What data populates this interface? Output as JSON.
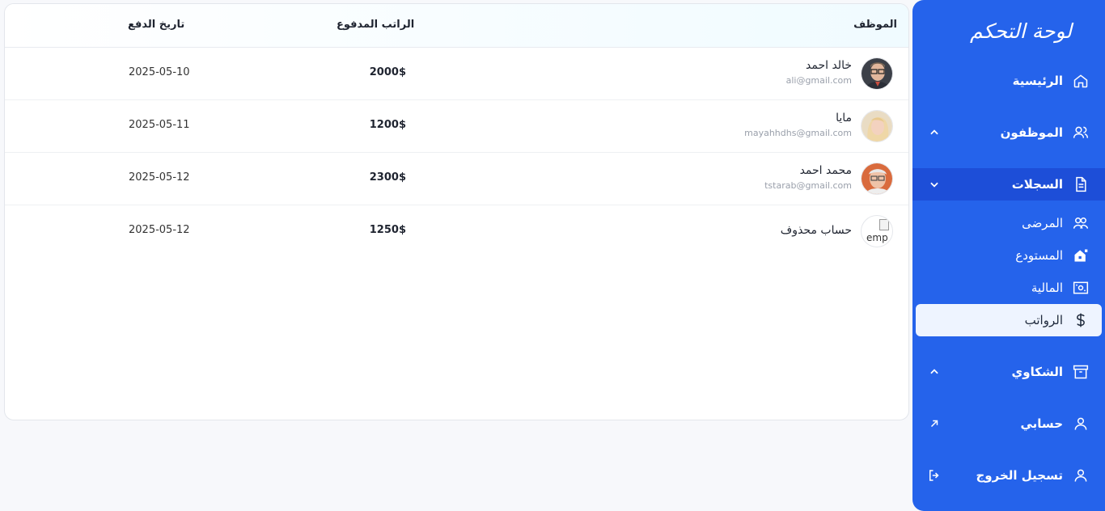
{
  "sidebar": {
    "title": "لوحة التحكم",
    "items": {
      "home": "الرئيسية",
      "employees": "الموظفون",
      "records": "السجلات",
      "complaints": "الشكاوي",
      "account": "حسابي",
      "logout": "تسجيل الخروج"
    },
    "records_sub": {
      "patients": "المرضى",
      "warehouse": "المستودع",
      "finance": "المالية",
      "salaries": "الرواتب"
    },
    "colors": {
      "background": "#2563eb",
      "active": "#1d4ed8",
      "selected": "#eef4ff"
    }
  },
  "table": {
    "headers": {
      "employee": "الموظف",
      "salary": "الراتب المدفوع",
      "date": "تاريخ الدفع"
    },
    "rows": [
      {
        "name": "خالد احمد",
        "email": "ali@gmail.com",
        "amount": "2000$",
        "date": "2025-05-10",
        "avatar": "avatar-man-glasses"
      },
      {
        "name": "مايا",
        "email": "mayahhdhs@gmail.com",
        "amount": "1200$",
        "date": "2025-05-11",
        "avatar": "avatar-woman-blonde"
      },
      {
        "name": "محمد احمد",
        "email": "tstarab@gmail.com",
        "amount": "2300$",
        "date": "2025-05-12",
        "avatar": "avatar-man-gray-hair"
      },
      {
        "name": "حساب محذوف",
        "email": "",
        "amount": "1250$",
        "date": "2025-05-12",
        "avatar": "broken-image",
        "avatar_alt": "emp"
      }
    ]
  }
}
